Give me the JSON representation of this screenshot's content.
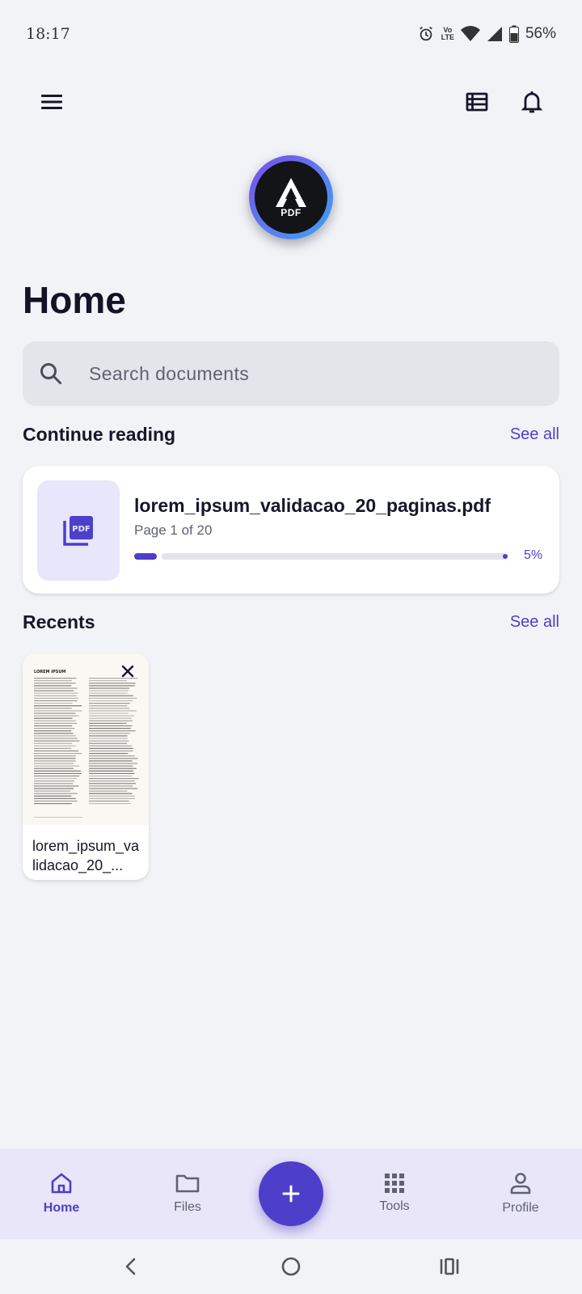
{
  "status_bar": {
    "time": "18:17",
    "volte_top": "Vo",
    "volte_bottom": "LTE",
    "battery": "56%"
  },
  "header": {
    "logo_text": "PDF",
    "title": "Home"
  },
  "search": {
    "placeholder": "Search documents"
  },
  "continue_reading": {
    "title": "Continue reading",
    "see_all": "See all",
    "doc": {
      "name": "lorem_ipsum_validacao_20_paginas.pdf",
      "page_info": "Page 1 of 20",
      "progress_percent": 5,
      "progress_label": "5%",
      "thumb_label": "PDF"
    }
  },
  "recents": {
    "title": "Recents",
    "see_all": "See all",
    "items": [
      {
        "name": "lorem_ipsum_validacao_20_...",
        "preview_heading": "LOREM IPSUM"
      }
    ]
  },
  "bottom_nav": {
    "items": [
      {
        "label": "Home",
        "icon": "home-icon",
        "active": true
      },
      {
        "label": "Files",
        "icon": "folder-icon",
        "active": false
      },
      {
        "label": "Tools",
        "icon": "grid-icon",
        "active": false
      },
      {
        "label": "Profile",
        "icon": "person-icon",
        "active": false
      }
    ],
    "fab_icon": "plus-icon"
  },
  "colors": {
    "accent": "#4d3fc9",
    "background": "#f2f3f7",
    "nav_background": "#e8e6f8"
  }
}
